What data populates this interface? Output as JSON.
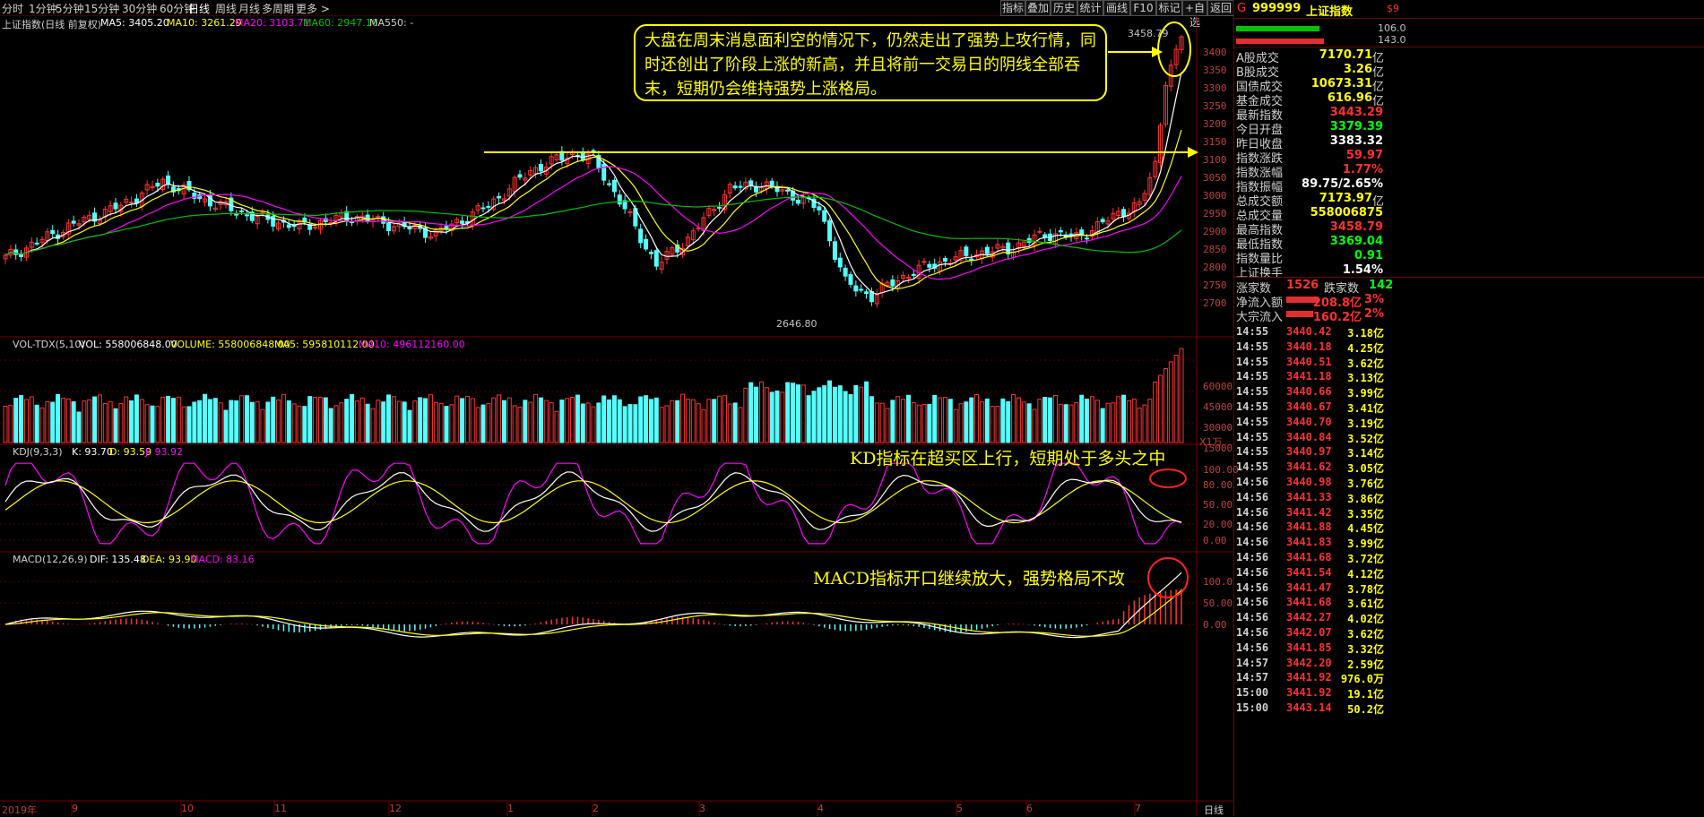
{
  "toolbar": {
    "timeframes": [
      "分时",
      "1分钟",
      "5分钟",
      "15分钟",
      "30分钟",
      "60分钟",
      "日线",
      "周线",
      "月线",
      "多周期",
      "更多 >"
    ],
    "selected": "日线",
    "right_buttons": [
      "指标",
      "叠加",
      "历史",
      "统计",
      "画线",
      "F10",
      "标记",
      "+自选",
      "返回"
    ]
  },
  "main_chart": {
    "title": "上证指数(日线 前复权)",
    "ma5": "MA5: 3405.20",
    "ma10": "MA10: 3261.29",
    "ma20": "MA20: 3103.71",
    "ma60": "MA60: 2947.10",
    "ma550": "MA550: -",
    "high_label": "3458.79",
    "low_label": "2646.80",
    "y_ticks": [
      "3400",
      "3350",
      "3300",
      "3250",
      "3200",
      "3150",
      "3100",
      "3050",
      "3000",
      "2950",
      "2900",
      "2850",
      "2800",
      "2750",
      "2700"
    ]
  },
  "volume_chart": {
    "title": "VOL-TDX(5,10)",
    "vol": "VOL: 558006848.00",
    "volume": "VOLUME: 558006848.00",
    "ma5": "MA5: 595810112.00",
    "ma10": "MA10: 496112160.00",
    "y_ticks": [
      "60000",
      "45000",
      "30000",
      "15000"
    ],
    "unit": "X1万"
  },
  "kdj_chart": {
    "title": "KDJ(9,3,3)",
    "k": "K: 93.70",
    "d": "D: 93.59",
    "j": "J: 93.92",
    "y_ticks": [
      "100.00",
      "80.00",
      "50.00",
      "20.00",
      "0.00"
    ]
  },
  "macd_chart": {
    "title": "MACD(12,26,9)",
    "dif": "DIF: 135.48",
    "dea": "DEA: 93.90",
    "macd": "MACD: 83.16",
    "y_ticks": [
      "100.0",
      "50.00",
      "0.00"
    ]
  },
  "x_axis": {
    "labels": [
      "2019年",
      "9",
      "10",
      "11",
      "12",
      "1",
      "2",
      "3",
      "4",
      "5",
      "6",
      "7"
    ],
    "period": "日线"
  },
  "annotations": {
    "main_callout": "大盘在周末消息面利空的情况下，仍然走出了强势上攻行情，同时还创出了阶段上涨的新高，并且将前一交易日的阴线全部吞末，短期仍会维持强势上涨格局。",
    "kd_note": "KD指标在超买区上行，短期处于多头之中",
    "macd_note": "MACD指标开口继续放大，强势格局不改"
  },
  "quote_panel": {
    "code": "999999",
    "name": "上证指数",
    "prefix": "G",
    "tag": "$9",
    "bar_values": [
      "106.0",
      "143.0"
    ],
    "rows": [
      {
        "label": "A股成交",
        "value": "7170.71",
        "unit": "亿",
        "color": "#ffff00"
      },
      {
        "label": "B股成交",
        "value": "3.26",
        "unit": "亿",
        "color": "#ffff00"
      },
      {
        "label": "国债成交",
        "value": "10673.31",
        "unit": "亿",
        "color": "#ffff00"
      },
      {
        "label": "基金成交",
        "value": "616.96",
        "unit": "亿",
        "color": "#ffff00"
      },
      {
        "label": "最新指数",
        "value": "3443.29",
        "unit": "",
        "color": "#ff3030"
      },
      {
        "label": "今日开盘",
        "value": "3379.39",
        "unit": "",
        "color": "#00ff00"
      },
      {
        "label": "昨日收盘",
        "value": "3383.32",
        "unit": "",
        "color": "#ffffff"
      },
      {
        "label": "指数涨跌",
        "value": "59.97",
        "unit": "",
        "color": "#ff3030"
      },
      {
        "label": "指数涨幅",
        "value": "1.77%",
        "unit": "",
        "color": "#ff3030"
      },
      {
        "label": "指数振幅",
        "value": "89.75/2.65%",
        "unit": "",
        "color": "#ffffff"
      },
      {
        "label": "总成交额",
        "value": "7173.97",
        "unit": "亿",
        "color": "#ffff00"
      },
      {
        "label": "总成交量",
        "value": "558006875",
        "unit": "",
        "color": "#ffff00"
      },
      {
        "label": "最高指数",
        "value": "3458.79",
        "unit": "",
        "color": "#ff3030"
      },
      {
        "label": "最低指数",
        "value": "3369.04",
        "unit": "",
        "color": "#00ff00"
      },
      {
        "label": "指数量比",
        "value": "0.91",
        "unit": "",
        "color": "#00ff00"
      },
      {
        "label": "上证换手",
        "value": "1.54%",
        "unit": "",
        "color": "#ffffff"
      }
    ],
    "advance_label": "涨家数",
    "advance_value": "1526",
    "decline_label": "跌家数",
    "decline_value": "142",
    "flows": [
      {
        "label": "净流入额",
        "value": "208.8亿",
        "pct": "3%"
      },
      {
        "label": "大宗流入",
        "value": "160.2亿",
        "pct": "2%"
      }
    ]
  },
  "ticks": [
    {
      "time": "14:55",
      "price": "3440.42",
      "vol": "3.18亿"
    },
    {
      "time": "14:55",
      "price": "3440.18",
      "vol": "4.25亿"
    },
    {
      "time": "14:55",
      "price": "3440.51",
      "vol": "3.62亿"
    },
    {
      "time": "14:55",
      "price": "3441.18",
      "vol": "3.13亿"
    },
    {
      "time": "14:55",
      "price": "3440.66",
      "vol": "3.99亿"
    },
    {
      "time": "14:55",
      "price": "3440.67",
      "vol": "3.41亿"
    },
    {
      "time": "14:55",
      "price": "3440.70",
      "vol": "3.19亿"
    },
    {
      "time": "14:55",
      "price": "3440.84",
      "vol": "3.52亿"
    },
    {
      "time": "14:55",
      "price": "3440.97",
      "vol": "3.14亿"
    },
    {
      "time": "14:55",
      "price": "3441.62",
      "vol": "3.05亿"
    },
    {
      "time": "14:56",
      "price": "3440.98",
      "vol": "3.76亿"
    },
    {
      "time": "14:56",
      "price": "3441.33",
      "vol": "3.86亿"
    },
    {
      "time": "14:56",
      "price": "3441.42",
      "vol": "3.35亿"
    },
    {
      "time": "14:56",
      "price": "3441.88",
      "vol": "4.45亿"
    },
    {
      "time": "14:56",
      "price": "3441.83",
      "vol": "3.99亿"
    },
    {
      "time": "14:56",
      "price": "3441.68",
      "vol": "3.72亿"
    },
    {
      "time": "14:56",
      "price": "3441.54",
      "vol": "4.12亿"
    },
    {
      "time": "14:56",
      "price": "3441.47",
      "vol": "3.78亿"
    },
    {
      "time": "14:56",
      "price": "3441.68",
      "vol": "3.61亿"
    },
    {
      "time": "14:56",
      "price": "3442.27",
      "vol": "4.02亿"
    },
    {
      "time": "14:56",
      "price": "3442.07",
      "vol": "3.62亿"
    },
    {
      "time": "14:56",
      "price": "3441.85",
      "vol": "3.32亿"
    },
    {
      "time": "14:57",
      "price": "3442.20",
      "vol": "2.59亿"
    },
    {
      "time": "14:57",
      "price": "3441.92",
      "vol": "976.0万"
    },
    {
      "time": "15:00",
      "price": "3441.92",
      "vol": "19.1亿"
    },
    {
      "time": "15:00",
      "price": "3443.14",
      "vol": "50.2亿"
    }
  ],
  "colors": {
    "up": "#ff3232",
    "down": "#54ffff",
    "ma5": "#ffffff",
    "ma10": "#ffff00",
    "ma20": "#ff00ff",
    "ma60": "#00c000",
    "accent": "#ffff00"
  }
}
